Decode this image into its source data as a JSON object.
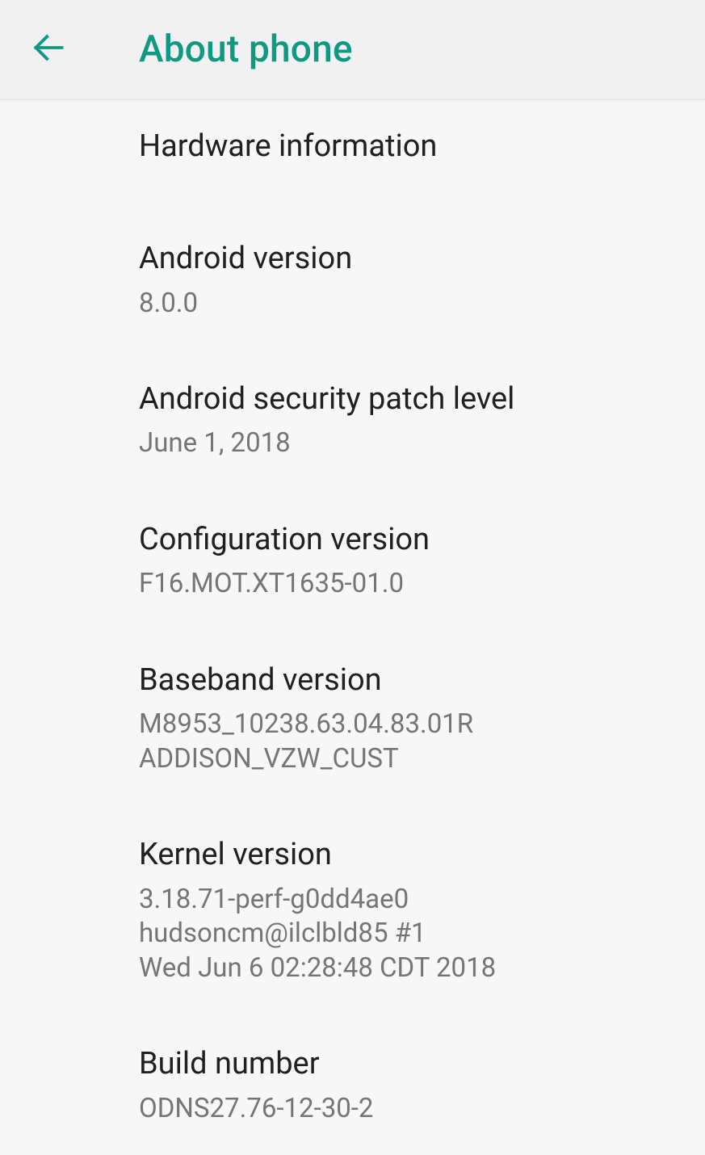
{
  "header": {
    "title": "About phone"
  },
  "items": [
    {
      "title": "Hardware information",
      "value": null
    },
    {
      "title": "Android version",
      "value": "8.0.0"
    },
    {
      "title": "Android security patch level",
      "value": "June 1, 2018"
    },
    {
      "title": "Configuration version",
      "value": "F16.MOT.XT1635-01.0"
    },
    {
      "title": "Baseband version",
      "value": "M8953_10238.63.04.83.01R ADDISON_VZW_CUST"
    },
    {
      "title": "Kernel version",
      "value": "3.18.71-perf-g0dd4ae0\nhudsoncm@ilclbld85 #1\nWed Jun 6 02:28:48 CDT 2018"
    },
    {
      "title": "Build number",
      "value": "ODNS27.76-12-30-2"
    }
  ]
}
